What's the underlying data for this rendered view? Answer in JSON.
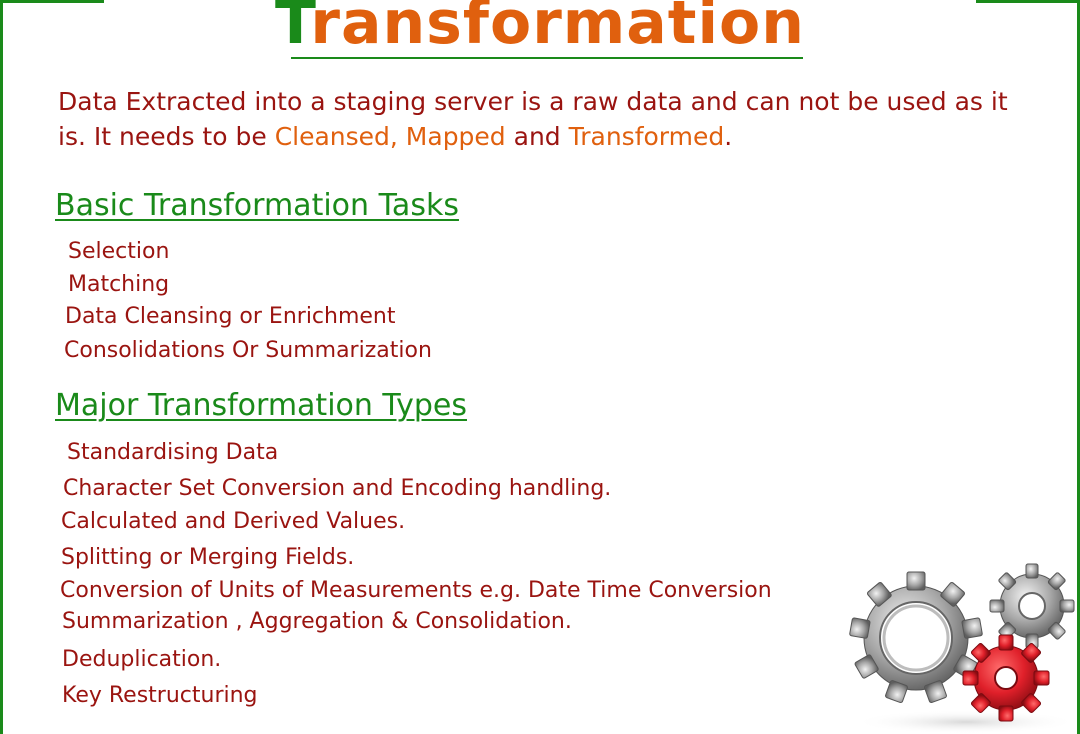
{
  "title": {
    "first_letter": "T",
    "rest": "ransformation"
  },
  "intro": {
    "part1": "Data Extracted into a staging server is a raw data and can not be used as it is. It needs to be ",
    "highlight1": "Cleansed, Mapped",
    "part2": " and ",
    "highlight2": "Transformed",
    "part3": "."
  },
  "basic": {
    "heading": "Basic Transformation Tasks",
    "items": [
      "Selection",
      "Matching",
      "Data Cleansing or Enrichment",
      "Consolidations Or Summarization"
    ]
  },
  "major": {
    "heading": "Major Transformation Types",
    "items": [
      "Standardising Data",
      "Character Set Conversion and Encoding handling.",
      "Calculated and Derived Values.",
      "Splitting or Merging Fields.",
      "Conversion of Units of Measurements e.g. Date Time Conversion",
      "Summarization , Aggregation & Consolidation.",
      "Deduplication.",
      "Key Restructuring"
    ]
  },
  "colors": {
    "green": "#1a8a1a",
    "orange": "#e0600e",
    "dark_red": "#9a1410",
    "gear_silver": "#9a9a9a",
    "gear_red": "#e0202a"
  },
  "icons": [
    "gears-icon"
  ]
}
